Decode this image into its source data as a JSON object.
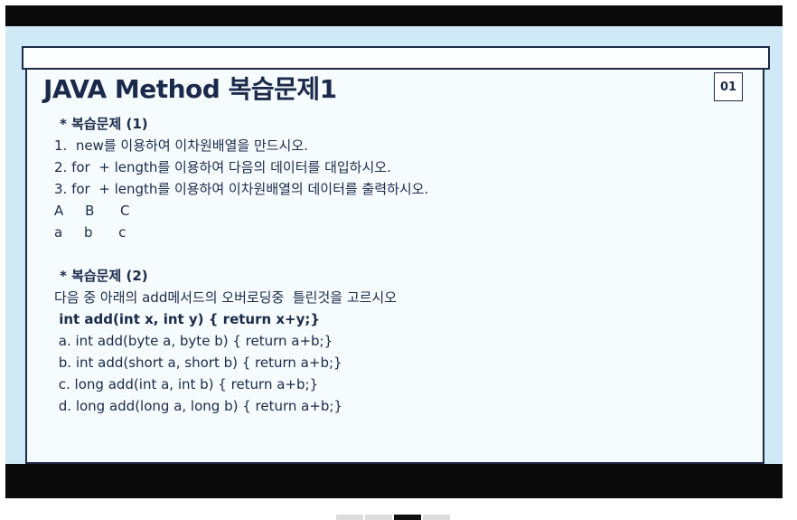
{
  "slide": {
    "title": "JAVA Method  복습문제1",
    "page_badge": "01",
    "lines": [
      {
        "text": "* 복습문제 (1)",
        "bold": true
      },
      {
        "text": "1.  new를 이용하여 이차원배열을 만드시오.",
        "bold": false
      },
      {
        "text": "2. for  + length를 이용하여 다음의 데이터를 대입하시오.",
        "bold": false
      },
      {
        "text": "3. for  + length를 이용하여 이차원배열의 데이터를 출력하시오.",
        "bold": false
      },
      {
        "text": "A     B      C",
        "bold": false
      },
      {
        "text": "a     b      c",
        "bold": false
      },
      {
        "text": "",
        "bold": false
      },
      {
        "text": "* 복습문제 (2)",
        "bold": true
      },
      {
        "text": "다음 중 아래의 add메서드의 오버로딩중  틀린것을 고르시오",
        "bold": false
      },
      {
        "text": " int add(int x, int y) { return x+y;}",
        "bold": true
      },
      {
        "text": " a. int add(byte a, byte b) { return a+b;}",
        "bold": false
      },
      {
        "text": " b. int add(short a, short b) { return a+b;}",
        "bold": false
      },
      {
        "text": " c. long add(int a, int b) { return a+b;}",
        "bold": false
      },
      {
        "text": " d. long add(long a, long b) { return a+b;}",
        "bold": false
      }
    ]
  },
  "pager": {
    "count": 4,
    "active_index": 2
  },
  "colors": {
    "slide_bg": "#cfe9f7",
    "ink": "#1b2a4a",
    "bar": "#0a0a0a"
  }
}
